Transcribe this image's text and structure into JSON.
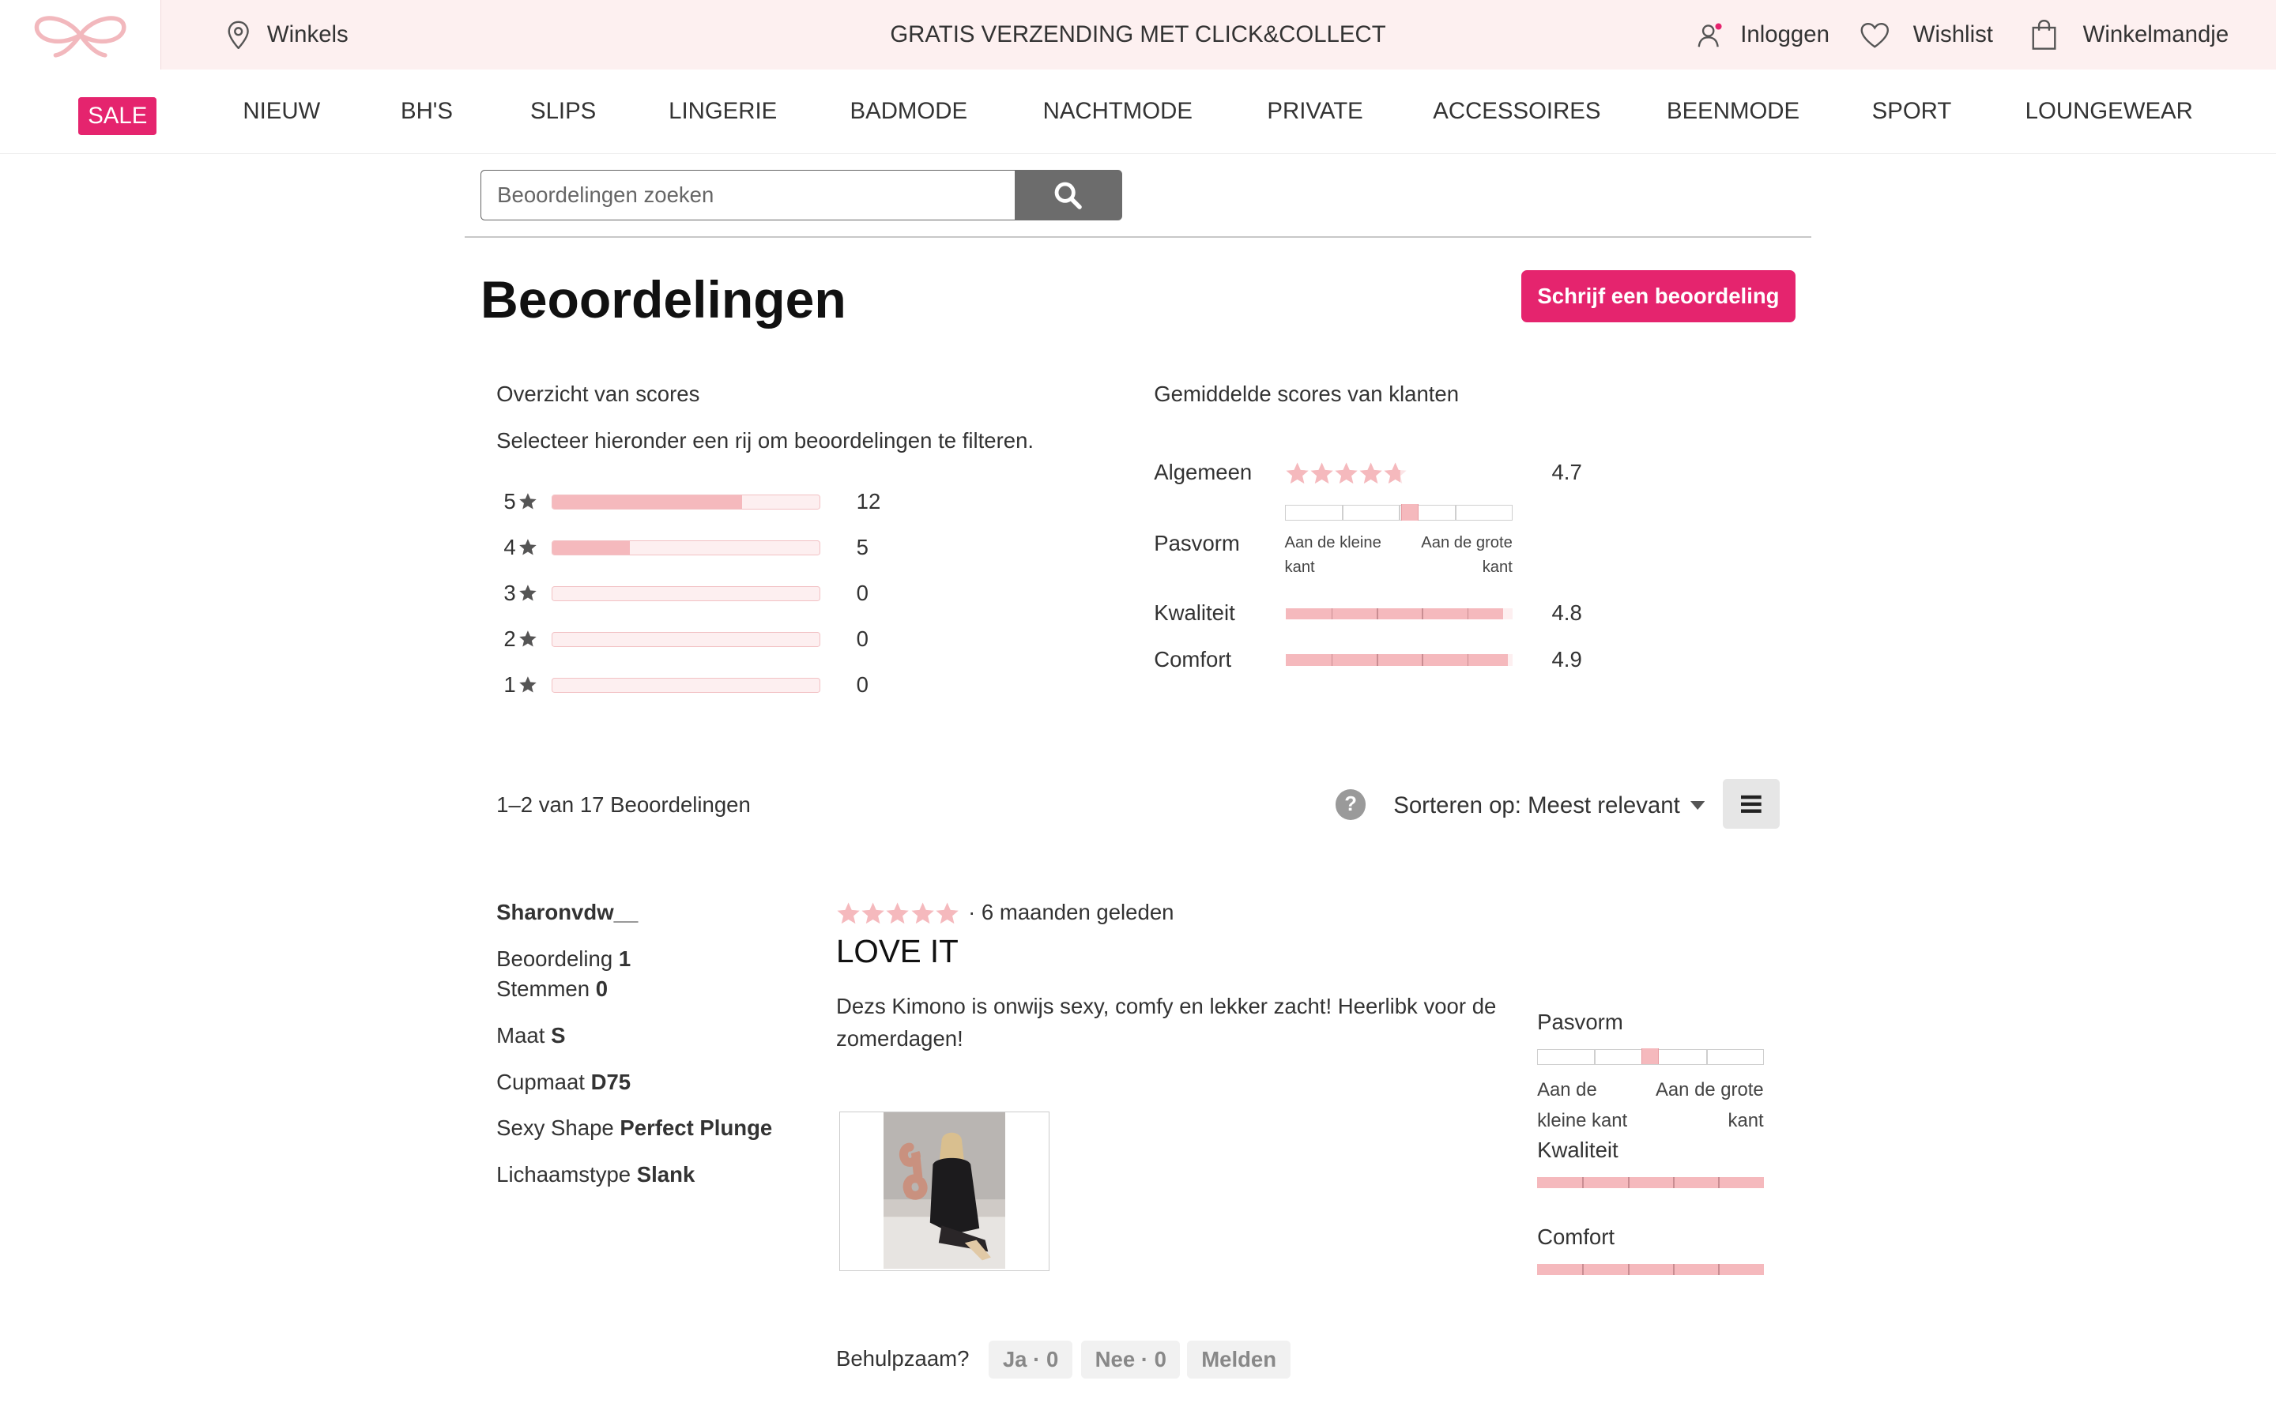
{
  "topbar": {
    "stores": "Winkels",
    "promo": "GRATIS VERZENDING MET CLICK&COLLECT",
    "login": "Inloggen",
    "wishlist": "Wishlist",
    "cart": "Winkelmandje"
  },
  "nav": {
    "sale": "SALE",
    "items": [
      "NIEUW",
      "BH'S",
      "SLIPS",
      "LINGERIE",
      "BADMODE",
      "NACHTMODE",
      "PRIVATE",
      "ACCESSOIRES",
      "BEENMODE",
      "SPORT",
      "LOUNGEWEAR"
    ]
  },
  "search": {
    "placeholder": "Beoordelingen zoeken"
  },
  "header": {
    "title": "Beoordelingen",
    "write_button": "Schrijf een beoordeling"
  },
  "overview": {
    "title": "Overzicht van scores",
    "hint": "Selecteer hieronder een rij om beoordelingen te filteren.",
    "rows": [
      {
        "label": "5",
        "count": "12",
        "fraction": 0.71
      },
      {
        "label": "4",
        "count": "5",
        "fraction": 0.29
      },
      {
        "label": "3",
        "count": "0",
        "fraction": 0
      },
      {
        "label": "2",
        "count": "0",
        "fraction": 0
      },
      {
        "label": "1",
        "count": "0",
        "fraction": 0
      }
    ]
  },
  "averages": {
    "title": "Gemiddelde scores van klanten",
    "overall_label": "Algemeen",
    "overall_value": "4.7",
    "overall_rating": 4.7,
    "fit_label": "Pasvorm",
    "fit_low": "Aan de kleine kant",
    "fit_high": "Aan de grote kant",
    "fit_position": 0.55,
    "quality_label": "Kwaliteit",
    "quality_value": "4.8",
    "quality_rating": 4.8,
    "comfort_label": "Comfort",
    "comfort_value": "4.9",
    "comfort_rating": 4.9
  },
  "list": {
    "count_text": "1–2 van 17 Beoordelingen",
    "help": "?",
    "sort_text": "Sorteren op: Meest relevant"
  },
  "review": {
    "author": "Sharonvdw__",
    "reviews_label": "Beoordeling",
    "reviews_value": "1",
    "votes_label": "Stemmen",
    "votes_value": "0",
    "size_label": "Maat",
    "size_value": "S",
    "cup_label": "Cupmaat",
    "cup_value": "D75",
    "shape_label": "Sexy Shape",
    "shape_value": "Perfect Plunge",
    "body_label": "Lichaamstype",
    "body_value": "Slank",
    "rating": 5,
    "age": "· 6 maanden geleden",
    "title": "LOVE IT",
    "text": "Dezs Kimono is onwijs sexy, comfy en lekker zacht! Heerlibk voor de zomerdagen!",
    "fit_label": "Pasvorm",
    "fit_low": "Aan de kleine kant",
    "fit_high": "Aan de grote kant",
    "fit_position": 0.5,
    "quality_label": "Kwaliteit",
    "quality_rating": 5,
    "comfort_label": "Comfort",
    "comfort_rating": 5,
    "helpful_label": "Behulpzaam?",
    "yes_button": "Ja · 0",
    "no_button": "Nee · 0",
    "report_button": "Melden"
  },
  "colors": {
    "brand_pink": "#e5246e",
    "star_pink": "#f5b9bd",
    "topbar_bg": "#fdf0f0"
  }
}
